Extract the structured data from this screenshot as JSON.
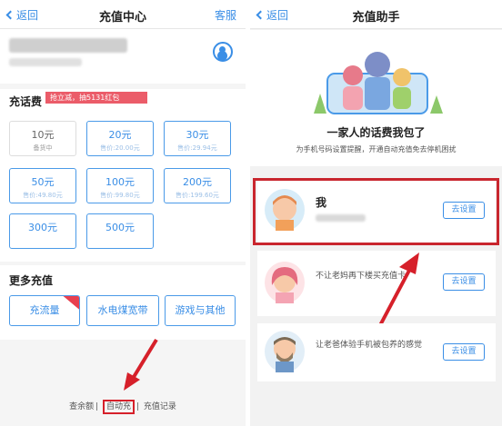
{
  "left": {
    "nav": {
      "back": "返回",
      "title": "充值中心",
      "right": "客服"
    },
    "phone_section": {
      "title": "充话费",
      "promo": "抢立减，抽5131红包"
    },
    "cards": [
      {
        "value": "10元",
        "price": "备货中"
      },
      {
        "value": "20元",
        "price": "售价:20.00元"
      },
      {
        "value": "30元",
        "price": "售价:29.94元"
      },
      {
        "value": "50元",
        "price": "售价:49.80元"
      },
      {
        "value": "100元",
        "price": "售价:99.80元"
      },
      {
        "value": "200元",
        "price": "售价:199.60元"
      },
      {
        "value": "300元",
        "price": ""
      },
      {
        "value": "500元",
        "price": ""
      }
    ],
    "more": {
      "title": "更多充值",
      "items": [
        "充流量",
        "水电煤宽带",
        "游戏与其他"
      ]
    },
    "footer": {
      "balance": "查余额",
      "auto": "自动充",
      "records": "充值记录"
    }
  },
  "right": {
    "nav": {
      "back": "返回",
      "title": "充值助手"
    },
    "hero": {
      "headline": "一家人的话费我包了",
      "subtitle": "为手机号码设置提醒，开通自动充值免去停机困扰"
    },
    "rows": [
      {
        "name": "我",
        "desc": "",
        "button": "去设置"
      },
      {
        "name": "",
        "desc": "不让老妈再下楼买充值卡",
        "button": "去设置"
      },
      {
        "name": "",
        "desc": "让老爸体验手机被包养的感觉",
        "button": "去设置"
      }
    ]
  },
  "colors": {
    "accent": "#3a8ee6",
    "highlight": "#c9262e"
  }
}
